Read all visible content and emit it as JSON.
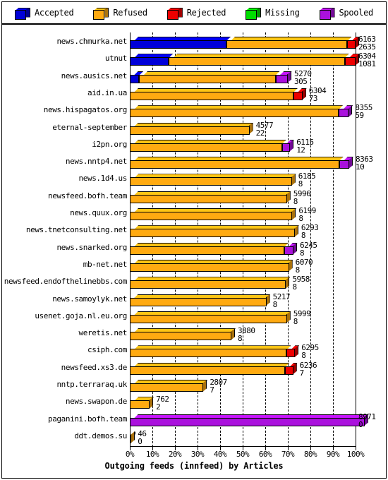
{
  "legend": {
    "items": [
      {
        "label": "Accepted",
        "color": "#0000d8",
        "icon": "cube-icon"
      },
      {
        "label": "Refused",
        "color": "#ffaa11",
        "icon": "cube-icon"
      },
      {
        "label": "Rejected",
        "color": "#ee0000",
        "icon": "cube-icon"
      },
      {
        "label": "Missing",
        "color": "#00dd00",
        "icon": "cube-icon"
      },
      {
        "label": "Spooled",
        "color": "#aa11dd",
        "icon": "cube-icon"
      }
    ]
  },
  "chart_data": {
    "type": "bar",
    "subtype": "stacked-horizontal-100pct-3d",
    "title": "Outgoing feeds (innfeed) by Articles",
    "xlabel": "Outgoing feeds (innfeed) by Articles",
    "ylabel": "",
    "xlim": [
      0,
      100
    ],
    "xticks": [
      0,
      10,
      20,
      30,
      40,
      50,
      60,
      70,
      80,
      90,
      100
    ],
    "xtick_labels": [
      "0%",
      "10%",
      "20%",
      "30%",
      "40%",
      "50%",
      "60%",
      "70%",
      "80%",
      "90%",
      "100%"
    ],
    "grid": true,
    "legend_position": "top",
    "series_names": [
      "Accepted",
      "Refused",
      "Rejected",
      "Missing",
      "Spooled"
    ],
    "series_colors": [
      "#0000d8",
      "#ffaa11",
      "#ee0000",
      "#00dd00",
      "#aa11dd"
    ],
    "categories": [
      "news.chmurka.net",
      "utnut",
      "news.ausics.net",
      "aid.in.ua",
      "news.hispagatos.org",
      "eternal-september",
      "i2pn.org",
      "news.nntp4.net",
      "news.1d4.us",
      "newsfeed.bofh.team",
      "news.quux.org",
      "news.tnetconsulting.net",
      "news.snarked.org",
      "mb-net.net",
      "newsfeed.endofthelinebbs.com",
      "news.samoylyk.net",
      "usenet.goja.nl.eu.org",
      "weretis.net",
      "csiph.com",
      "newsfeed.xs3.de",
      "nntp.terraraq.uk",
      "news.swapon.de",
      "paganini.bofh.team",
      "ddt.demos.su"
    ],
    "rows": [
      {
        "label": "news.chmurka.net",
        "value_top": "6163",
        "value_bottom": "2635",
        "total_pct": 100.0,
        "segments": [
          {
            "name": "Accepted",
            "pct": 42.8
          },
          {
            "name": "Refused",
            "pct": 53.6
          },
          {
            "name": "Rejected",
            "pct": 3.6
          }
        ]
      },
      {
        "label": "utnut",
        "value_top": "6304",
        "value_bottom": "1081",
        "total_pct": 100.0,
        "segments": [
          {
            "name": "Accepted",
            "pct": 17.2
          },
          {
            "name": "Refused",
            "pct": 78.0
          },
          {
            "name": "Rejected",
            "pct": 4.8
          }
        ]
      },
      {
        "label": "news.ausics.net",
        "value_top": "5270",
        "value_bottom": "305",
        "total_pct": 70.0,
        "segments": [
          {
            "name": "Accepted",
            "pct": 4.2
          },
          {
            "name": "Refused",
            "pct": 60.4
          },
          {
            "name": "Spooled",
            "pct": 5.4
          }
        ]
      },
      {
        "label": "aid.in.ua",
        "value_top": "6304",
        "value_bottom": "73",
        "total_pct": 76.5,
        "segments": [
          {
            "name": "Refused",
            "pct": 72.5
          },
          {
            "name": "Rejected",
            "pct": 4.0
          }
        ]
      },
      {
        "label": "news.hispagatos.org",
        "value_top": "8355",
        "value_bottom": "59",
        "total_pct": 97.0,
        "segments": [
          {
            "name": "Refused",
            "pct": 92.5
          },
          {
            "name": "Spooled",
            "pct": 4.5
          }
        ]
      },
      {
        "label": "eternal-september",
        "value_top": "4577",
        "value_bottom": "22",
        "total_pct": 53.0,
        "segments": [
          {
            "name": "Refused",
            "pct": 53.0
          }
        ]
      },
      {
        "label": "i2pn.org",
        "value_top": "6115",
        "value_bottom": "12",
        "total_pct": 71.0,
        "segments": [
          {
            "name": "Refused",
            "pct": 67.5
          },
          {
            "name": "Spooled",
            "pct": 3.5
          }
        ]
      },
      {
        "label": "news.nntp4.net",
        "value_top": "8363",
        "value_bottom": "10",
        "total_pct": 97.2,
        "segments": [
          {
            "name": "Refused",
            "pct": 92.7
          },
          {
            "name": "Spooled",
            "pct": 4.5
          }
        ]
      },
      {
        "label": "news.1d4.us",
        "value_top": "6185",
        "value_bottom": "8",
        "total_pct": 71.8,
        "segments": [
          {
            "name": "Refused",
            "pct": 71.8
          }
        ]
      },
      {
        "label": "newsfeed.bofh.team",
        "value_top": "5996",
        "value_bottom": "8",
        "total_pct": 69.6,
        "segments": [
          {
            "name": "Refused",
            "pct": 69.6
          }
        ]
      },
      {
        "label": "news.quux.org",
        "value_top": "6199",
        "value_bottom": "8",
        "total_pct": 72.0,
        "segments": [
          {
            "name": "Refused",
            "pct": 72.0
          }
        ]
      },
      {
        "label": "news.tnetconsulting.net",
        "value_top": "6293",
        "value_bottom": "8",
        "total_pct": 73.1,
        "segments": [
          {
            "name": "Refused",
            "pct": 73.1
          }
        ]
      },
      {
        "label": "news.snarked.org",
        "value_top": "6245",
        "value_bottom": "8",
        "total_pct": 72.5,
        "segments": [
          {
            "name": "Refused",
            "pct": 68.5
          },
          {
            "name": "Spooled",
            "pct": 4.0
          }
        ]
      },
      {
        "label": "mb-net.net",
        "value_top": "6070",
        "value_bottom": "8",
        "total_pct": 70.5,
        "segments": [
          {
            "name": "Refused",
            "pct": 70.5
          }
        ]
      },
      {
        "label": "newsfeed.endofthelinebbs.com",
        "value_top": "5958",
        "value_bottom": "8",
        "total_pct": 69.2,
        "segments": [
          {
            "name": "Refused",
            "pct": 69.2
          }
        ]
      },
      {
        "label": "news.samoylyk.net",
        "value_top": "5217",
        "value_bottom": "8",
        "total_pct": 60.5,
        "segments": [
          {
            "name": "Refused",
            "pct": 60.5
          }
        ]
      },
      {
        "label": "usenet.goja.nl.eu.org",
        "value_top": "5999",
        "value_bottom": "8",
        "total_pct": 69.6,
        "segments": [
          {
            "name": "Refused",
            "pct": 69.6
          }
        ]
      },
      {
        "label": "weretis.net",
        "value_top": "3880",
        "value_bottom": "8",
        "total_pct": 45.0,
        "segments": [
          {
            "name": "Refused",
            "pct": 45.0
          }
        ]
      },
      {
        "label": "csiph.com",
        "value_top": "6295",
        "value_bottom": "8",
        "total_pct": 73.2,
        "segments": [
          {
            "name": "Refused",
            "pct": 69.5
          },
          {
            "name": "Rejected",
            "pct": 3.7
          }
        ]
      },
      {
        "label": "newsfeed.xs3.de",
        "value_top": "6236",
        "value_bottom": "7",
        "total_pct": 72.4,
        "segments": [
          {
            "name": "Refused",
            "pct": 68.9
          },
          {
            "name": "Rejected",
            "pct": 3.5
          }
        ]
      },
      {
        "label": "nntp.terraraq.uk",
        "value_top": "2807",
        "value_bottom": "7",
        "total_pct": 32.6,
        "segments": [
          {
            "name": "Refused",
            "pct": 32.6
          }
        ]
      },
      {
        "label": "news.swapon.de",
        "value_top": "762",
        "value_bottom": "2",
        "total_pct": 8.8,
        "segments": [
          {
            "name": "Refused",
            "pct": 8.8
          }
        ]
      },
      {
        "label": "paganini.bofh.team",
        "value_top": "8971",
        "value_bottom": "0",
        "total_pct": 104.0,
        "segments": [
          {
            "name": "Spooled",
            "pct": 104.0
          }
        ]
      },
      {
        "label": "ddt.demos.su",
        "value_top": "46",
        "value_bottom": "0",
        "total_pct": 0.7,
        "segments": [
          {
            "name": "Refused",
            "pct": 0.7
          }
        ]
      }
    ]
  }
}
